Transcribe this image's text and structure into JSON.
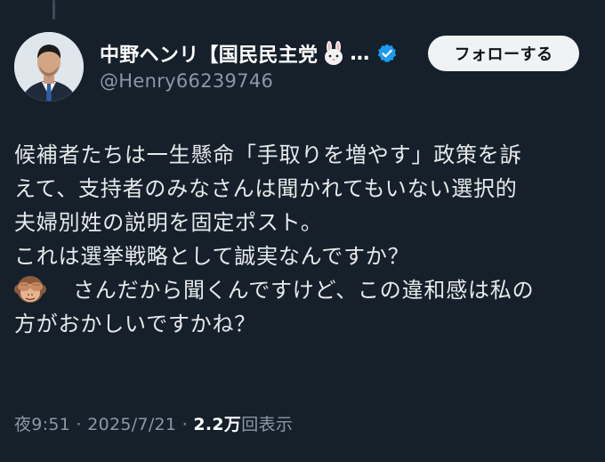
{
  "author": {
    "display_name": "中野ヘンリ【国民民主党",
    "ellipsis": "…",
    "handle": "@Henry66239746"
  },
  "follow_label": "フォローする",
  "body_lines": [
    "候補者たちは一生懸命「手取りを増やす」政策を訴",
    "えて、支持者のみなさんは聞かれてもいない選択的",
    "夫婦別姓の説明を固定ポスト。",
    "これは選挙戦略として誠実なんですか？",
    "さんだから聞くんですけど、この違和感は私の",
    "方がおかしいですかね？"
  ],
  "meta": {
    "time": "夜9:51",
    "sep1": " · ",
    "date": "2025/7/21",
    "sep2": " · ",
    "views_count": "2.2万",
    "views_label": "回表示"
  },
  "colors": {
    "background": "#15202b",
    "text": "#e7e9ea",
    "secondary": "#8b98a5",
    "verified": "#1d9bf0",
    "button_bg": "#eff3f4"
  },
  "icons": [
    "rabbit-icon",
    "verified-badge-icon",
    "see-no-evil-monkey-icon"
  ]
}
